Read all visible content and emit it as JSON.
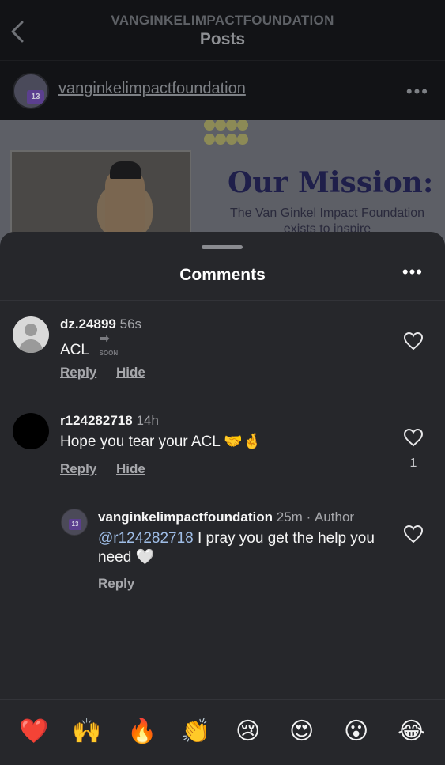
{
  "header": {
    "account": "VANGINKELIMPACTFOUNDATION",
    "title": "Posts"
  },
  "post": {
    "username": "vanginkelimpactfoundation",
    "avatar_badge": "13",
    "image": {
      "heading": "Our Mission:",
      "text": "The Van Ginkel Impact Foundation exists to inspire"
    }
  },
  "sheet": {
    "title": "Comments"
  },
  "comments": [
    {
      "username": "dz.24899",
      "time": "56s",
      "text": "ACL",
      "sticker": "SOON",
      "reply_label": "Reply",
      "hide_label": "Hide"
    },
    {
      "username": "r124282718",
      "time": "14h",
      "text": "Hope you tear your ACL 🤝🤞",
      "reply_label": "Reply",
      "hide_label": "Hide",
      "likes": "1"
    }
  ],
  "reply": {
    "username": "vanginkelimpactfoundation",
    "time": "25m",
    "author_label": "Author",
    "mention": "@r124282718",
    "text": " I pray you get the help you need 🤍",
    "reply_label": "Reply",
    "avatar_badge": "13"
  },
  "reactions": [
    "❤️",
    "🙌",
    "🔥",
    "👏",
    "😢",
    "😍",
    "😮",
    "😂"
  ],
  "colors": {
    "sheet_background": "#26272b",
    "mention": "#9fbde6",
    "muted_text": "#a6a7ab"
  }
}
